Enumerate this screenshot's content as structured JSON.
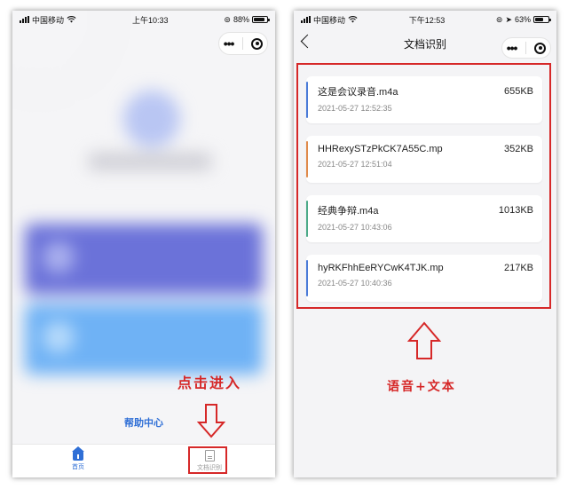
{
  "left_phone": {
    "status": {
      "carrier": "中国移动",
      "time": "上午10:33",
      "battery": "88%",
      "battery_level": 0.88
    },
    "help_center_label": "帮助中心",
    "tabs": [
      {
        "label": "首页",
        "active": true,
        "icon": "home-icon"
      },
      {
        "label": "文档识别",
        "active": false,
        "icon": "document-icon"
      }
    ]
  },
  "right_phone": {
    "status": {
      "carrier": "中国移动",
      "time": "下午12:53",
      "battery": "63%",
      "battery_level": 0.63
    },
    "title": "文档识别",
    "files": [
      {
        "name": "这是会议录音.m4a",
        "size": "655KB",
        "time": "2021-05-27 12:52:35",
        "accent": "#4a7bd8"
      },
      {
        "name": "HHRexySTzPkCK7A55C.mp",
        "size": "352KB",
        "time": "2021-05-27 12:51:04",
        "accent": "#e08a4a"
      },
      {
        "name": "经典争辩.m4a",
        "size": "1013KB",
        "time": "2021-05-27 10:43:06",
        "accent": "#4caa88"
      },
      {
        "name": "hyRKFhhEeRYCwK4TJK.mp",
        "size": "217KB",
        "time": "2021-05-27 10:40:36",
        "accent": "#4a7bd8"
      }
    ]
  },
  "annotations": {
    "click_enter": "点击进入",
    "voice_text": "语音+文本",
    "color": "#d62828"
  }
}
